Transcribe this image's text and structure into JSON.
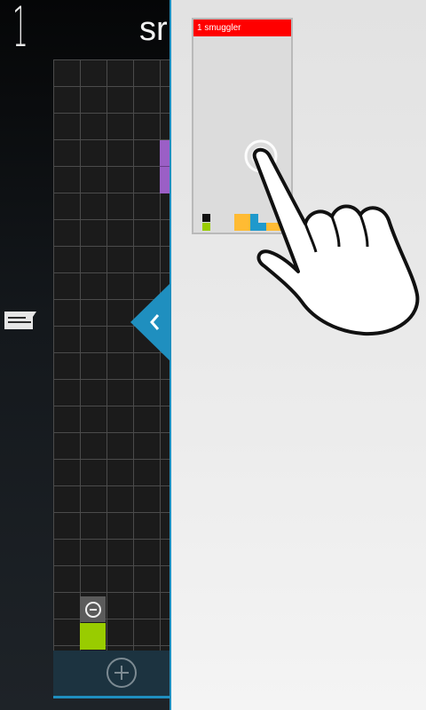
{
  "level": {
    "number": "1",
    "title": "sr"
  },
  "board": {
    "colors": {
      "background": "#1b1b1b",
      "grid_line": "#4b4b4b",
      "purple": "#9b5fc6",
      "green": "#99cc00",
      "accent": "#1f8fbf"
    },
    "icons": {
      "remove": "minus-circle-icon",
      "add": "plus-circle-icon",
      "chat": "chat-bubble-icon",
      "drawer": "chevron-left-icon"
    }
  },
  "preview": {
    "label": "1 smuggler",
    "header_color": "#ff0000",
    "pieces": [
      "black",
      "green",
      "yellow",
      "blue",
      "yellow",
      "green"
    ]
  },
  "tutorial": {
    "gesture_icon": "tap-hand-icon"
  }
}
